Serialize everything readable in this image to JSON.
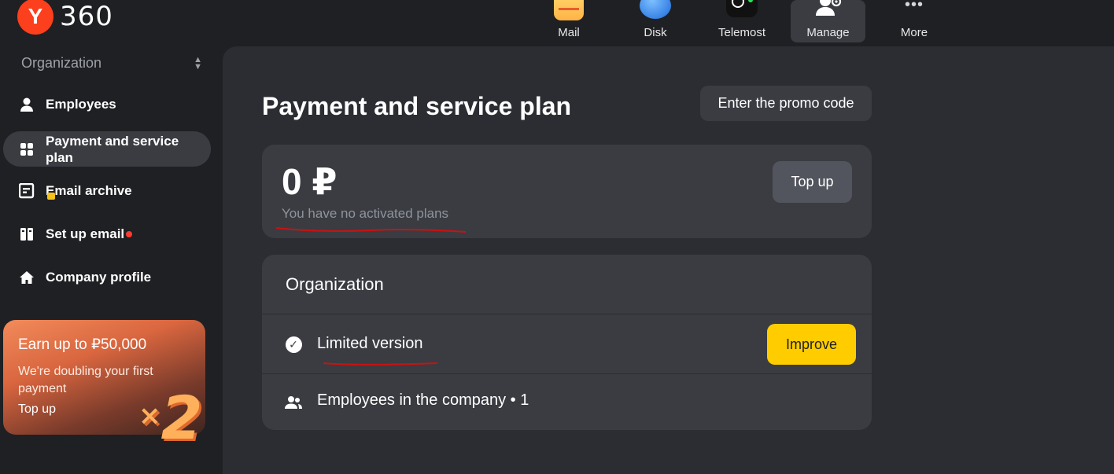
{
  "logo": {
    "mark": "Y",
    "text": "360"
  },
  "topnav": {
    "items": [
      {
        "label": "Mail",
        "icon": "mail-icon"
      },
      {
        "label": "Disk",
        "icon": "disk-icon"
      },
      {
        "label": "Telemost",
        "icon": "telemost-icon"
      },
      {
        "label": "Manage",
        "icon": "manage-icon",
        "active": true
      },
      {
        "label": "More",
        "icon": "more-icon"
      }
    ],
    "more_glyph": "•••"
  },
  "sidebar": {
    "org_selector": "Organization",
    "items": [
      {
        "label": "Employees",
        "icon": "person-icon"
      },
      {
        "label": "Payment and service plan",
        "icon": "grid-icon",
        "active": true
      },
      {
        "label": "Email archive",
        "icon": "archive-icon"
      },
      {
        "label": "Set up email",
        "icon": "setup-email-icon",
        "has_notification": true
      },
      {
        "label": "Company profile",
        "icon": "home-icon"
      }
    ],
    "promo": {
      "title": "Earn up to ₽50,000",
      "subtitle": "We're doubling your first payment",
      "link": "Top up",
      "multiplier_x": "×",
      "multiplier_n": "2"
    }
  },
  "main": {
    "title": "Payment and service plan",
    "promo_code_button": "Enter the promo code",
    "balance": {
      "amount": "0 ₽",
      "note": "You have no activated plans",
      "topup_button": "Top up"
    },
    "organization": {
      "title": "Organization",
      "plan_label": "Limited version",
      "improve_button": "Improve",
      "employees_text": "Employees in the company • 1"
    }
  },
  "colors": {
    "brand_red": "#fc3f1d",
    "accent_yellow": "#ffcc00",
    "annotation_red": "#cc1111",
    "notification_red": "#ff3b30"
  }
}
